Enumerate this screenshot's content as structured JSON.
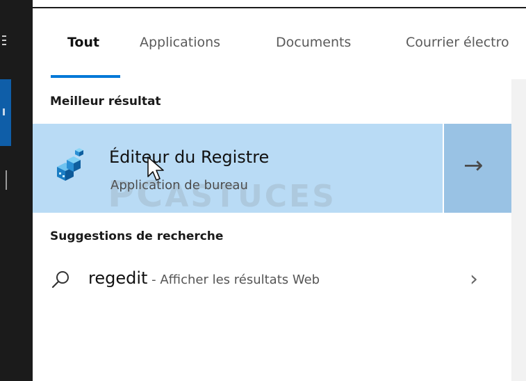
{
  "tabs": [
    {
      "label": "Tout",
      "active": true
    },
    {
      "label": "Applications",
      "active": false
    },
    {
      "label": "Documents",
      "active": false
    },
    {
      "label": "Courrier électro",
      "active": false
    }
  ],
  "best_result": {
    "heading": "Meilleur résultat",
    "app_name": "Éditeur du Registre",
    "app_type": "Application de bureau",
    "icon": "registry-editor-icon",
    "open_arrow": "→"
  },
  "suggestions": {
    "heading": "Suggestions de recherche",
    "items": [
      {
        "query": "regedit",
        "description": " - Afficher les résultats Web",
        "icon": "search-icon",
        "chevron": "›"
      }
    ]
  },
  "watermark": {
    "pc": "PC",
    "text": "ASTUCES"
  },
  "colors": {
    "accent": "#0078d7",
    "selected_row": "#b9dbf5",
    "arrow_box": "#99c2e4",
    "taskbar": "#1b1b1b"
  }
}
